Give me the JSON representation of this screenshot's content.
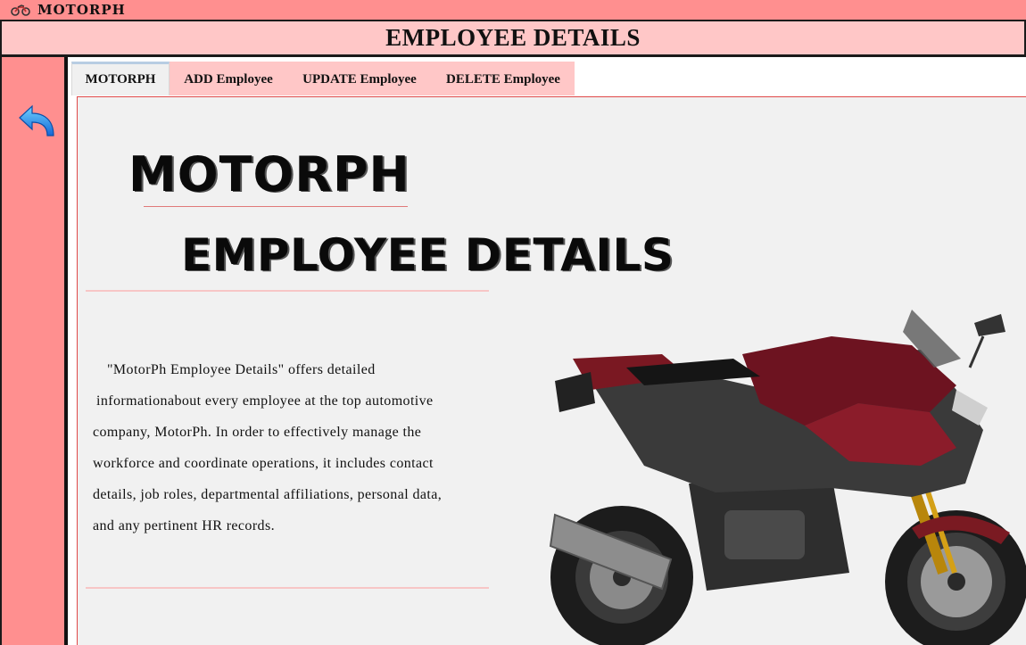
{
  "window": {
    "title": "MOTORPH",
    "icon": "motorcycle-icon"
  },
  "header": {
    "title": "EMPLOYEE DETAILS"
  },
  "sidebar": {
    "back_icon": "back-arrow-icon"
  },
  "tabs": [
    {
      "label": "MOTORPH",
      "active": true
    },
    {
      "label": "ADD Employee",
      "active": false
    },
    {
      "label": "UPDATE Employee",
      "active": false
    },
    {
      "label": "DELETE Employee",
      "active": false
    }
  ],
  "panel": {
    "heading_line1": "MOTORPH",
    "heading_line2": "EMPLOYEE DETAILS",
    "description_lines": [
      "\"MotorPh Employee Details\" offers detailed",
      "informationabout every employee at the top automotive",
      "company, MotorPh. In order to effectively manage the",
      "workforce and coordinate operations, it includes contact",
      "details, job roles, departmental affiliations, personal data,",
      "and any pertinent HR records."
    ],
    "image": "motorcycle-image"
  },
  "colors": {
    "sidebar": "#ff8f8f",
    "header": "#ffc7c7",
    "back_arrow": "#1e90ff",
    "panel_border": "#e04a4a"
  }
}
